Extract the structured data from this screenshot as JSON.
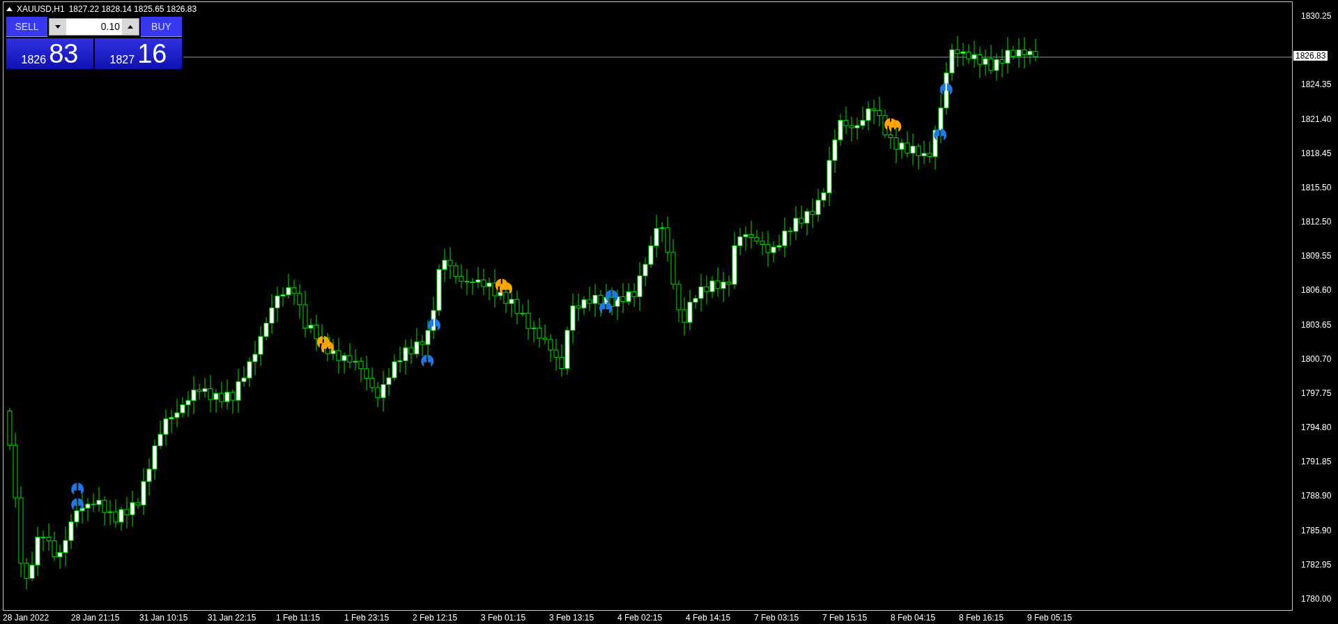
{
  "header": {
    "symbol": "XAUUSD,H1",
    "quotes": "1827.22 1828.14 1825.65 1826.83"
  },
  "trade_panel": {
    "sell_label": "SELL",
    "buy_label": "BUY",
    "lot": "0.10",
    "bid_big": "83",
    "bid_small": "1826",
    "ask_small": "1827",
    "ask_big": "16"
  },
  "price_axis": [
    "1830.25",
    "1824.35",
    "1821.40",
    "1818.45",
    "1815.50",
    "1812.50",
    "1809.55",
    "1806.60",
    "1803.65",
    "1800.70",
    "1797.75",
    "1794.80",
    "1791.85",
    "1788.90",
    "1785.90",
    "1782.95",
    "1780.00"
  ],
  "current_price": "1826.83",
  "time_axis": [
    "28 Jan 2022",
    "28 Jan 21:15",
    "31 Jan 10:15",
    "31 Jan 22:15",
    "1 Feb 11:15",
    "1 Feb 23:15",
    "2 Feb 12:15",
    "3 Feb 01:15",
    "3 Feb 13:15",
    "4 Feb 02:15",
    "4 Feb 14:15",
    "7 Feb 03:15",
    "7 Feb 15:15",
    "8 Feb 04:15",
    "8 Feb 16:15",
    "9 Feb 05:15"
  ]
}
